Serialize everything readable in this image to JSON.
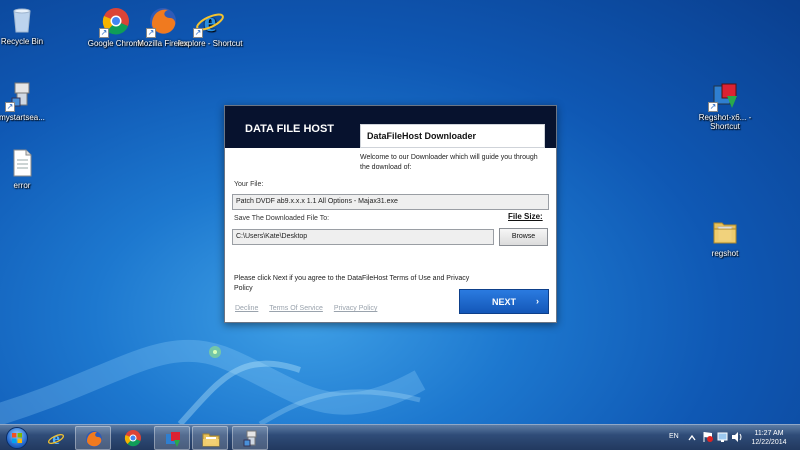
{
  "desktop": {
    "icons": [
      {
        "label": "Recycle Bin",
        "icon": "recycle-bin-icon"
      },
      {
        "label": "Google Chrome",
        "icon": "chrome-icon"
      },
      {
        "label": "Mozilla Firefox",
        "icon": "firefox-icon"
      },
      {
        "label": "iexplore - Shortcut",
        "icon": "internet-explorer-icon"
      },
      {
        "label": "mystartsea...",
        "icon": "program-shortcut-icon"
      },
      {
        "label": "error",
        "icon": "text-document-icon"
      },
      {
        "label": "Regshot-x6... - Shortcut",
        "icon": "regshot-shortcut-icon"
      },
      {
        "label": "regshot",
        "icon": "folder-icon"
      }
    ]
  },
  "dialog": {
    "brand": "DATA FILE HOST",
    "title": "DataFileHost Downloader",
    "welcome": "Welcome to our Downloader which will guide you through the download of:",
    "your_file_label": "Your File:",
    "your_file_value": "Patch DVDF ab9.x.x.x 1.1 All Options - Majax31.exe",
    "save_to_label": "Save The Downloaded File To:",
    "save_to_value": "C:\\Users\\Kate\\Desktop",
    "file_size_label": "File Size:",
    "browse_label": "Browse",
    "agree_text": "Please click Next if you agree to the DataFileHost Terms of Use and Privacy Policy",
    "links": {
      "decline": "Decline",
      "terms": "Terms Of Service",
      "privacy": "Privacy Policy"
    },
    "next_label": "NEXT",
    "next_arrow": "›"
  },
  "taskbar": {
    "pinned": [
      {
        "name": "internet-explorer",
        "icon": "internet-explorer-icon"
      },
      {
        "name": "firefox",
        "icon": "firefox-icon"
      },
      {
        "name": "chrome",
        "icon": "chrome-icon"
      },
      {
        "name": "app",
        "icon": "app-icon"
      },
      {
        "name": "explorer",
        "icon": "folder-icon"
      },
      {
        "name": "downloader",
        "icon": "program-shortcut-icon"
      }
    ],
    "language": "EN",
    "time": "11:27 AM",
    "date": "12/22/2014"
  },
  "colors": {
    "dialog_header": "#07122e",
    "next_button": "#1b67cc",
    "desktop_blue": "#1d78cf"
  }
}
